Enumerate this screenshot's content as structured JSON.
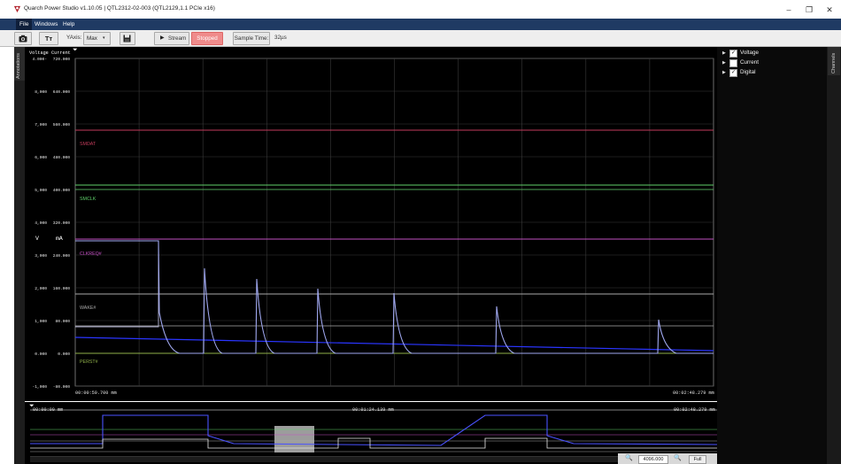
{
  "window": {
    "title": "Quarch Power Studio v1.10.05 | QTL2312-02-003 (QTL2129,1.1 PCIe x16)",
    "minimize": "–",
    "restore": "❐",
    "close": "✕"
  },
  "menu": [
    {
      "label": "File"
    },
    {
      "label": "Windows"
    },
    {
      "label": "Help"
    }
  ],
  "toolbar": {
    "camera_icon": "camera-icon",
    "text_tool_label": "Tт",
    "yaxis_label": "YAxis:",
    "yaxis_value": "Max",
    "save_icon": "save-icon",
    "stream_label": "Stream",
    "status_label": "Stopped",
    "sample_time_label": "Sample Time:",
    "sample_time_value": "32µs",
    "colors": {
      "stopped": "#ef8b8b"
    }
  },
  "side_tabs": {
    "annotations": "Annotations",
    "channels": "Channels"
  },
  "channels_panel": {
    "items": [
      {
        "label": "Voltage",
        "checked": true
      },
      {
        "label": "Current",
        "checked": false
      },
      {
        "label": "Digital",
        "checked": true
      }
    ]
  },
  "plot": {
    "header_voltage": "Voltage",
    "header_current": "Current",
    "unit_voltage": "V",
    "unit_current": "mA",
    "voltage_ticks": [
      "4.000-",
      "8,000",
      "7,000",
      "6,000",
      "5,000",
      "4,000",
      "3,000",
      "2,000",
      "1,000",
      "0.000",
      "-1,000"
    ],
    "current_ticks": [
      "720.000",
      "640.000",
      "560.000",
      "480.000",
      "400.000",
      "320.000",
      "240.000",
      "160.000",
      "80.000",
      "0.000",
      "-80.000"
    ],
    "digital_labels": [
      {
        "label": "SMDAT",
        "color": "#c23b5b"
      },
      {
        "label": "SMCLK",
        "color": "#5fcf6a"
      },
      {
        "label": "CLKREQ#",
        "color": "#c24fc2"
      },
      {
        "label": "WAKE#",
        "color": "#aaaaaa"
      },
      {
        "label": "PERST#",
        "color": "#8fb04a"
      }
    ],
    "time_start": "00:00:59.700 mm",
    "time_end": "00:02:48.279 mm",
    "colors": {
      "trace": "#a0a8f0",
      "voltage_line": "#2a35ff",
      "grid": "#3a3a3a"
    }
  },
  "overview": {
    "time_start": "00:00:00 mm",
    "time_mid": "00:01:24.139 mm",
    "time_end": "00:02:48.279 mm",
    "zoom_value": "4096.000",
    "full_label": "Full"
  }
}
